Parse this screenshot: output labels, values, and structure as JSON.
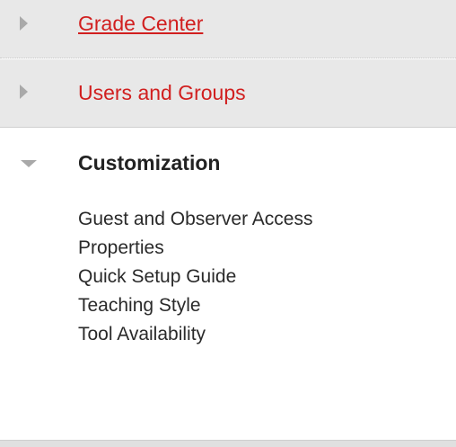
{
  "menu": {
    "sections": [
      {
        "label": "Grade Center",
        "state": "collapsed",
        "style": "link-underlined"
      },
      {
        "label": "Users and Groups",
        "state": "collapsed",
        "style": "link"
      },
      {
        "label": "Customization",
        "state": "expanded"
      }
    ],
    "customization_items": [
      {
        "label": "Guest and Observer Access"
      },
      {
        "label": "Properties"
      },
      {
        "label": "Quick Setup Guide"
      },
      {
        "label": "Teaching Style"
      },
      {
        "label": "Tool Availability"
      }
    ],
    "icons": {
      "collapsed": "caret-right-icon",
      "expanded": "caret-down-icon"
    },
    "colors": {
      "link": "#d11f1f",
      "collapsed_bg": "#e8e8e8",
      "arrow": "#a9a9a9",
      "text": "#222222"
    }
  }
}
